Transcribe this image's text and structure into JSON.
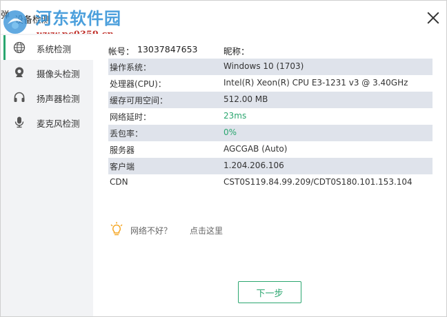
{
  "window": {
    "title": "设备检测",
    "edge_glyph": "弹"
  },
  "watermark": {
    "site_name": "河东软件园",
    "url": "www.pc0359.cn"
  },
  "sidebar": {
    "items": [
      {
        "label": "系统检测",
        "icon": "globe-icon",
        "active": true
      },
      {
        "label": "摄像头检测",
        "icon": "webcam-icon",
        "active": false
      },
      {
        "label": "扬声器检测",
        "icon": "headphones-icon",
        "active": false
      },
      {
        "label": "麦克风检测",
        "icon": "microphone-icon",
        "active": false
      }
    ]
  },
  "account": {
    "id_label": "帐号：",
    "id_value": "13037847653",
    "nickname_label": "昵称："
  },
  "info": {
    "rows": [
      {
        "key": "操作系统：",
        "value": "Windows 10 (1703)"
      },
      {
        "key": "处理器(CPU)：",
        "value": "Intel(R) Xeon(R) CPU E3-1231 v3 @ 3.40GHz"
      },
      {
        "key": "缓存可用空间：",
        "value": "512.00 MB"
      },
      {
        "key": "网络延时：",
        "value": "23ms"
      },
      {
        "key": "丢包率：",
        "value": "0%"
      },
      {
        "key": "服务器",
        "value": "AGCGAB (Auto)"
      },
      {
        "key": "客户端",
        "value": "1.204.206.106"
      },
      {
        "key": "CDN",
        "value": "CST0S119.84.99.209/CDT0S180.101.153.104"
      }
    ]
  },
  "tip": {
    "text": "网络不好？",
    "link": "点击这里"
  },
  "buttons": {
    "next": "下一步"
  },
  "colors": {
    "accent": "#2aa66f",
    "row_shade": "#dfe3eb",
    "sidebar_bg": "#f2f3f5",
    "bulb": "#f5a623"
  }
}
